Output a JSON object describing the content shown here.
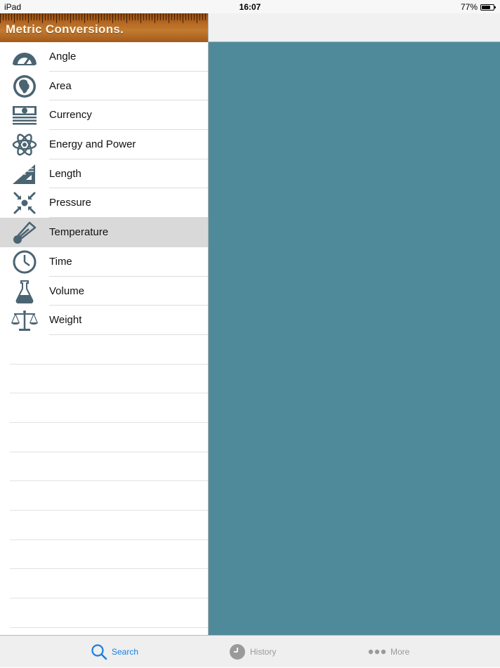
{
  "status_bar": {
    "device": "iPad",
    "time": "16:07",
    "battery": "77%",
    "battery_level": 0.77
  },
  "header": {
    "title": "Metric Conversions."
  },
  "categories": [
    {
      "label": "Angle",
      "icon": "protractor-icon",
      "selected": false
    },
    {
      "label": "Area",
      "icon": "globe-icon",
      "selected": false
    },
    {
      "label": "Currency",
      "icon": "banknotes-icon",
      "selected": false
    },
    {
      "label": "Energy and Power",
      "icon": "atom-icon",
      "selected": false
    },
    {
      "label": "Length",
      "icon": "set-square-icon",
      "selected": false
    },
    {
      "label": "Pressure",
      "icon": "compress-arrows-icon",
      "selected": false
    },
    {
      "label": "Temperature",
      "icon": "thermometer-icon",
      "selected": true
    },
    {
      "label": "Time",
      "icon": "clock-icon",
      "selected": false
    },
    {
      "label": "Volume",
      "icon": "flask-icon",
      "selected": false
    },
    {
      "label": "Weight",
      "icon": "scales-icon",
      "selected": false
    }
  ],
  "colors": {
    "accent": "#1a7fe0",
    "icon": "#4a6472",
    "detail_background": "#4f8a9b",
    "header_wood": "#b76a24",
    "selected_row": "#d9d9d9"
  },
  "tabs": [
    {
      "label": "Search",
      "icon": "magnifier-icon",
      "active": true
    },
    {
      "label": "History",
      "icon": "clock-icon",
      "active": false
    },
    {
      "label": "More",
      "icon": "ellipsis-icon",
      "active": false
    }
  ]
}
